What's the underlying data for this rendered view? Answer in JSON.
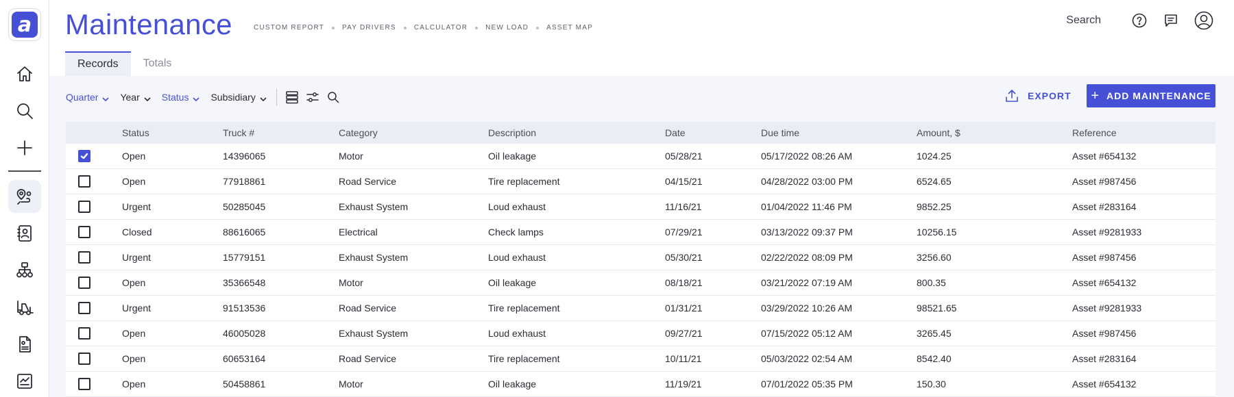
{
  "app": {
    "logo_letter": "a",
    "title": "Maintenance",
    "accent_color": "#4650d6"
  },
  "sidebar": {
    "items": [
      {
        "icon": "home-icon"
      },
      {
        "icon": "search-icon"
      },
      {
        "icon": "plus-icon"
      },
      {
        "icon": "route-icon",
        "active": true
      },
      {
        "icon": "contacts-icon"
      },
      {
        "icon": "org-chart-icon"
      },
      {
        "icon": "forklift-icon"
      },
      {
        "icon": "document-icon"
      },
      {
        "icon": "report-icon"
      }
    ]
  },
  "quicklinks": [
    "CUSTOM REPORT",
    "PAY DRIVERS",
    "CALCULATOR",
    "NEW LOAD",
    "ASSET MAP"
  ],
  "header": {
    "search_label": "Search",
    "icons": [
      "help-icon",
      "chat-icon",
      "account-icon"
    ]
  },
  "tabs": [
    {
      "label": "Records",
      "active": true
    },
    {
      "label": "Totals",
      "active": false
    }
  ],
  "filters": [
    {
      "label": "Quarter",
      "accent": true
    },
    {
      "label": "Year",
      "accent": false
    },
    {
      "label": "Status",
      "accent": true
    },
    {
      "label": "Subsidiary",
      "accent": false
    }
  ],
  "actions": {
    "export_label": "EXPORT",
    "add_label": "ADD MAINTENANCE"
  },
  "table": {
    "columns": [
      "Status",
      "Truck #",
      "Category",
      "Description",
      "Date",
      "Due time",
      "Amount, $",
      "Reference"
    ],
    "rows": [
      {
        "checked": true,
        "cells": [
          "Open",
          "14396065",
          "Motor",
          "Oil leakage",
          "05/28/21",
          "05/17/2022 08:26 AM",
          "1024.25",
          "Asset #654132"
        ]
      },
      {
        "checked": false,
        "cells": [
          "Open",
          "77918861",
          "Road Service",
          "Tire replacement",
          "04/15/21",
          "04/28/2022 03:00 PM",
          "6524.65",
          "Asset #987456"
        ]
      },
      {
        "checked": false,
        "cells": [
          "Urgent",
          "50285045",
          "Exhaust System",
          "Loud exhaust",
          "11/16/21",
          "01/04/2022 11:46 PM",
          "9852.25",
          "Asset #283164"
        ]
      },
      {
        "checked": false,
        "cells": [
          "Closed",
          "88616065",
          "Electrical",
          "Check lamps",
          "07/29/21",
          "03/13/2022 09:37 PM",
          "10256.15",
          "Asset #9281933"
        ]
      },
      {
        "checked": false,
        "cells": [
          "Urgent",
          "15779151",
          "Exhaust System",
          "Loud exhaust",
          "05/30/21",
          "02/22/2022 08:09 PM",
          "3256.60",
          "Asset #987456"
        ]
      },
      {
        "checked": false,
        "cells": [
          "Open",
          "35366548",
          "Motor",
          "Oil leakage",
          "08/18/21",
          "03/21/2022 07:19 AM",
          "800.35",
          "Asset #654132"
        ]
      },
      {
        "checked": false,
        "cells": [
          "Urgent",
          "91513536",
          "Road Service",
          "Tire replacement",
          "01/31/21",
          "03/29/2022 10:26 AM",
          "98521.65",
          "Asset #9281933"
        ]
      },
      {
        "checked": false,
        "cells": [
          "Open",
          "46005028",
          "Exhaust System",
          "Loud exhaust",
          "09/27/21",
          "07/15/2022 05:12 AM",
          "3265.45",
          "Asset #987456"
        ]
      },
      {
        "checked": false,
        "cells": [
          "Open",
          "60653164",
          "Road Service",
          "Tire replacement",
          "10/11/21",
          "05/03/2022 02:54 AM",
          "8542.40",
          "Asset #283164"
        ]
      },
      {
        "checked": false,
        "cells": [
          "Open",
          "50458861",
          "Motor",
          "Oil leakage",
          "11/19/21",
          "07/01/2022 05:35 PM",
          "150.30",
          "Asset #654132"
        ]
      }
    ]
  }
}
